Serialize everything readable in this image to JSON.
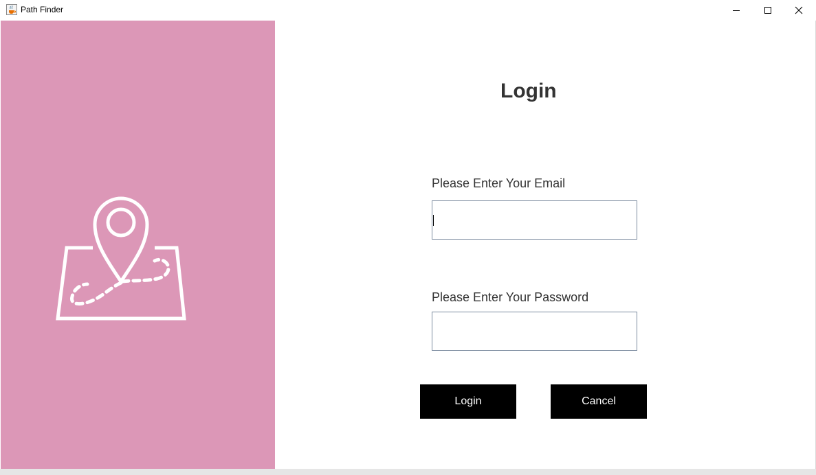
{
  "window": {
    "title": "Path Finder",
    "icon": "java-cup-icon",
    "controls": [
      "minimize-icon",
      "maximize-icon",
      "close-icon"
    ]
  },
  "sidebar": {
    "background_color": "#dc97b7",
    "illustration": "map-pin-route-icon"
  },
  "form": {
    "heading": "Login",
    "email_label": "Please Enter Your Email",
    "email_value": "",
    "password_label": "Please Enter Your Password",
    "password_value": "",
    "login_label": "Login",
    "cancel_label": "Cancel"
  },
  "colors": {
    "accent": "#dc97b7",
    "button_bg": "#000000",
    "button_text": "#ffffff",
    "heading_text": "#333333"
  }
}
